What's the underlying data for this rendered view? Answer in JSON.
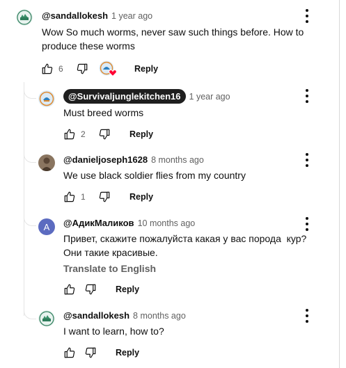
{
  "top_comment": {
    "author": "@sandallokesh",
    "time": "1 year ago",
    "text_line1": "Wow So much worms, never saw such things before. How to",
    "text_line2": "produce these worms",
    "likes": "6",
    "reply_label": "Reply"
  },
  "replies": [
    {
      "author": "@Survivaljunglekitchen16",
      "time": "1 year ago",
      "text": "Must breed worms",
      "likes": "2",
      "reply_label": "Reply"
    },
    {
      "author": "@danieljoseph1628",
      "time": "8 months ago",
      "text": "We use black soldier flies from my country",
      "likes": "1",
      "reply_label": "Reply"
    },
    {
      "author": "@АдикМаликов",
      "avatar_letter": "А",
      "time": "10 months ago",
      "text_line1": "Привет, скажите пожалуйста какая у вас порода  кур?",
      "text_line2": "Они такие красивые.",
      "translate_label": "Translate to English",
      "reply_label": "Reply"
    },
    {
      "author": "@sandallokesh",
      "time": "8 months ago",
      "text": "I want to learn, how to?",
      "reply_label": "Reply"
    }
  ],
  "colors": {
    "text": "#0f0f0f",
    "secondary": "#606060",
    "badge_bg": "#1f1f1f",
    "letter_avatar_bg": "#5c6bc0",
    "heart": "#ff0033"
  }
}
